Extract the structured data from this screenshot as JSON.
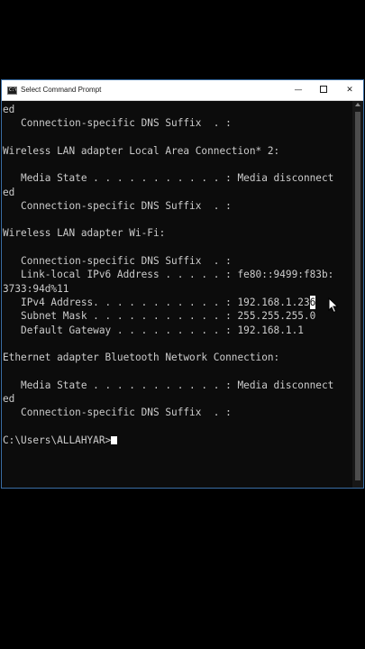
{
  "window": {
    "title": "Select Command Prompt",
    "icon": "cmd-icon",
    "controls": {
      "minimize": "—",
      "close": "✕"
    }
  },
  "console": {
    "lines": [
      "ed",
      "   Connection-specific DNS Suffix  . :",
      "",
      "Wireless LAN adapter Local Area Connection* 2:",
      "",
      "   Media State . . . . . . . . . . . : Media disconnect",
      "ed",
      "   Connection-specific DNS Suffix  . :",
      "",
      "Wireless LAN adapter Wi-Fi:",
      "",
      "   Connection-specific DNS Suffix  . :",
      "   Link-local IPv6 Address . . . . . : fe80::9499:f83b:",
      "3733:94d%11",
      "   IPv4 Address. . . . . . . . . . . : 192.168.1.23",
      "   Subnet Mask . . . . . . . . . . . : 255.255.255.0",
      "   Default Gateway . . . . . . . . . : 192.168.1.1",
      "",
      "Ethernet adapter Bluetooth Network Connection:",
      "",
      "   Media State . . . . . . . . . . . : Media disconnect",
      "ed",
      "   Connection-specific DNS Suffix  . :",
      "",
      "C:\\Users\\ALLAHYAR>"
    ],
    "selected_char": "6"
  },
  "colors": {
    "console_bg": "#0c0c0c",
    "console_fg": "#cccccc",
    "titlebar_bg": "#ffffff"
  }
}
